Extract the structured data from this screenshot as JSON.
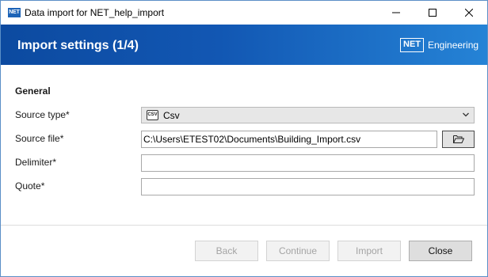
{
  "window": {
    "app_icon_text": "NET",
    "title": "Data import for NET_help_import"
  },
  "banner": {
    "title": "Import settings (1/4)",
    "logo_box_text": "NET",
    "logo_text": "Engineering"
  },
  "form": {
    "section_title": "General",
    "source_type": {
      "label": "Source type*",
      "icon": "csv-file-icon",
      "icon_text": "CSV",
      "value": "Csv"
    },
    "source_file": {
      "label": "Source file*",
      "value": "C:\\Users\\ETEST02\\Documents\\Building_Import.csv"
    },
    "delimiter": {
      "label": "Delimiter*",
      "value": ""
    },
    "quote": {
      "label": "Quote*",
      "value": ""
    }
  },
  "buttons": {
    "back": "Back",
    "continue": "Continue",
    "import": "Import",
    "close": "Close"
  },
  "colors": {
    "banner_start": "#0c4aa0",
    "banner_end": "#2583d6",
    "window_border": "#5b8fc7"
  }
}
